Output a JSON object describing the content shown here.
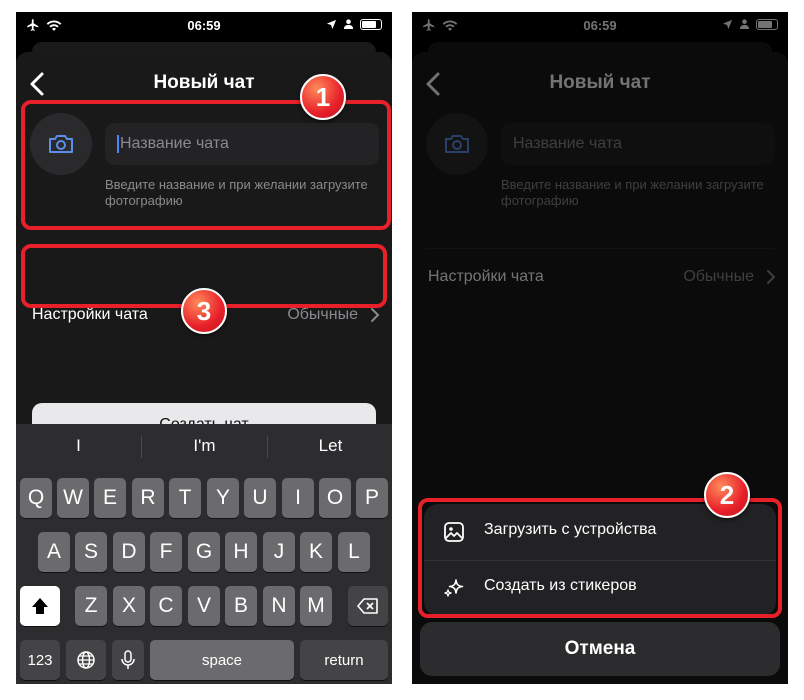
{
  "status_bar": {
    "time": "06:59"
  },
  "screen": {
    "title": "Новый чат",
    "name_placeholder": "Название чата",
    "hint": "Введите название и при желании загрузите фотографию",
    "settings_label": "Настройки чата",
    "settings_value": "Обычные",
    "create_button": "Создать чат"
  },
  "keyboard": {
    "suggestions": [
      "I",
      "I'm",
      "Let"
    ],
    "row1": [
      "Q",
      "W",
      "E",
      "R",
      "T",
      "Y",
      "U",
      "I",
      "O",
      "P"
    ],
    "row2": [
      "A",
      "S",
      "D",
      "F",
      "G",
      "H",
      "J",
      "K",
      "L"
    ],
    "row3": [
      "Z",
      "X",
      "C",
      "V",
      "B",
      "N",
      "M"
    ],
    "numbers_key": "123",
    "space_key": "space",
    "return_key": "return"
  },
  "action_sheet": {
    "items": [
      {
        "label": "Загрузить с устройства",
        "icon": "image-icon"
      },
      {
        "label": "Создать из стикеров",
        "icon": "sparkle-icon"
      }
    ],
    "cancel": "Отмена"
  },
  "callouts": [
    "1",
    "2",
    "3"
  ],
  "colors": {
    "highlight": "#e8202a",
    "accent": "#4a87ff"
  }
}
